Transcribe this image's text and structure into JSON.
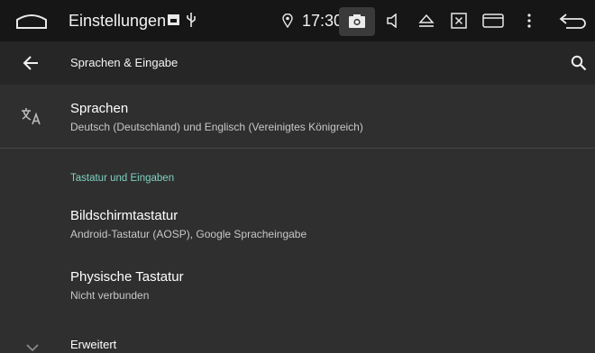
{
  "statusbar": {
    "app_title": "Einstellungen",
    "time": "17:30",
    "icons": [
      "home-icon",
      "screenshot-notification-icon",
      "usb-icon",
      "location-icon",
      "camera-icon",
      "volume-icon",
      "eject-icon",
      "close-box-icon",
      "window-icon",
      "more-icon",
      "back-icon"
    ]
  },
  "appbar": {
    "title": "Sprachen & Eingabe",
    "icons": [
      "back-arrow-icon",
      "search-icon"
    ]
  },
  "items": [
    {
      "title": "Sprachen",
      "subtitle": "Deutsch (Deutschland) und Englisch (Vereinigtes Königreich)",
      "icon": "translate-icon"
    },
    {
      "section": "Tastatur und Eingaben"
    },
    {
      "title": "Bildschirmtastatur",
      "subtitle": "Android-Tastatur (AOSP), Google Spracheingabe"
    },
    {
      "title": "Physische Tastatur",
      "subtitle": "Nicht verbunden"
    },
    {
      "title": "Erweitert"
    }
  ],
  "colors": {
    "section_accent": "#7fd1c2",
    "statusbar_bg": "#161616",
    "appbar_bg": "#262626",
    "content_bg": "#2f2f2f"
  }
}
